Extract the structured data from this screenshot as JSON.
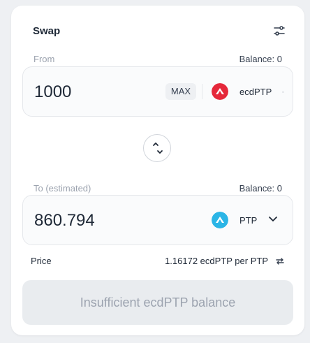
{
  "swap": {
    "title": "Swap",
    "from": {
      "label": "From",
      "balance_label": "Balance: 0",
      "amount": "1000",
      "max_label": "MAX",
      "token": "ecdPTP",
      "token_color": "#e5283a"
    },
    "to": {
      "label": "To (estimated)",
      "balance_label": "Balance: 0",
      "amount": "860.794",
      "token": "PTP",
      "token_color": "#2bb5e6"
    },
    "price": {
      "label": "Price",
      "value": "1.16172 ecdPTP per PTP"
    },
    "submit_label": "Insufficient ecdPTP balance",
    "icons": {
      "settings": "settings-sliders-icon",
      "swap_direction": "swap-direction-icon",
      "chevron": "chevron-down-icon",
      "invert_price": "invert-price-icon"
    }
  }
}
